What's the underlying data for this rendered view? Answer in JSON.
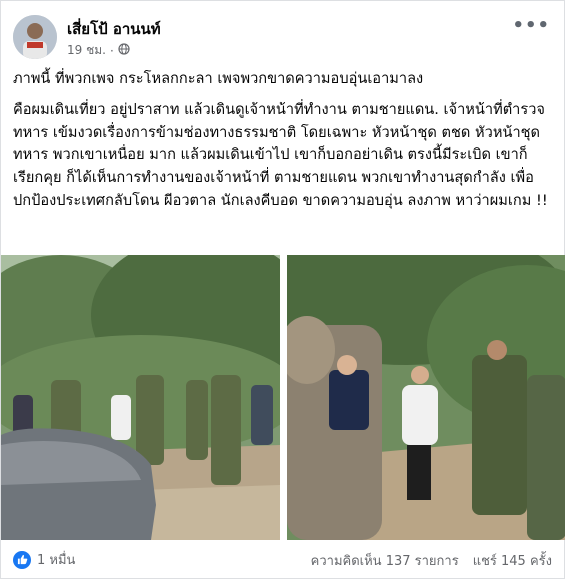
{
  "post": {
    "author": "เสี่ยโป้ อานนท์",
    "time": "19 ชม.",
    "privacy_icon": "globe-icon",
    "more_icon": "more-options-icon",
    "paragraphs": [
      "ภาพนี้ ที่พวกเพจ กระโหลกกะลา เพจพวกขาดความอบอุ่นเอามาลง",
      "คือผมเดินเที่ยว อยู่ปราสาท แล้วเดินดูเจ้าหน้าที่ทำงาน ตามชายแดน. เจ้าหน้าที่ตำรวจ ทหาร เข้มงวดเรื่องการข้ามช่องทางธรรมชาติ โดยเฉพาะ หัวหน้าชุด ตชด หัวหน้าชุดทหาร พวกเขาเหนื่อย มาก แล้วผมเดินเข้าไป เขาก็บอกอย่าเดิน ตรงนี้มีระเบิด เขาก็เรียกคุย ก็ได้เห็นการทำงานของเจ้าหน้าที่ ตามชายแดน พวกเขาทำงานสุดกำลัง เพื่อปกป้องประเทศกลับโดน ผีอวตาล นักเลงคีบอด ขาดความอบอุ่น ลงภาพ หาว่าผมเกม !!"
    ]
  },
  "footer": {
    "like_icon": "like-icon",
    "like_count": "1 หมื่น",
    "comments": "ความคิดเห็น 137 รายการ",
    "shares": "แชร์ 145 ครั้ง"
  },
  "colors": {
    "accent": "#1877f2",
    "secondary_text": "#65676b"
  }
}
